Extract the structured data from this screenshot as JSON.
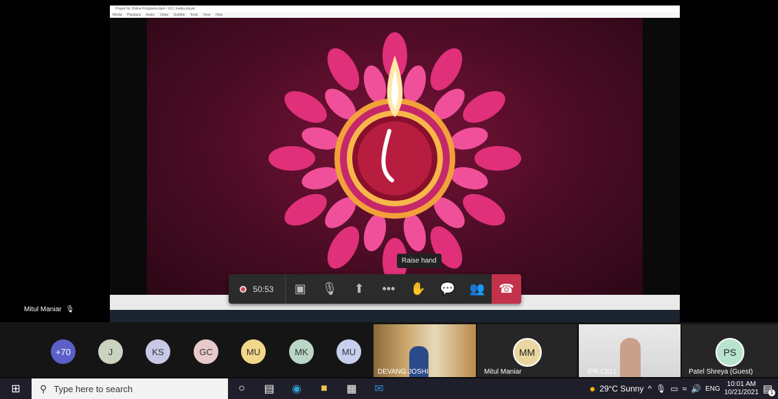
{
  "shared_window": {
    "title": "Prayer for Online Programs.mp4 - VLC media player",
    "menu": [
      "Media",
      "Playback",
      "Audio",
      "Video",
      "Subtitle",
      "Tools",
      "View",
      "Help"
    ]
  },
  "meeting": {
    "timer": "50:53",
    "tooltip": "Raise hand",
    "presenter_name": "Mitul Maniar"
  },
  "participants": {
    "overflow": "+70",
    "avatars": [
      {
        "initials": "J",
        "color": "#c9d3c0"
      },
      {
        "initials": "KS",
        "color": "#c7c7e6"
      },
      {
        "initials": "GC",
        "color": "#e8c9c9"
      },
      {
        "initials": "MU",
        "color": "#f2d68a"
      },
      {
        "initials": "MK",
        "color": "#b9d6c6"
      },
      {
        "initials": "MU",
        "color": "#c7cfee"
      }
    ],
    "tiles": [
      {
        "label": "DEVANG JOSHI"
      },
      {
        "label": "Mitul Maniar",
        "initials": "MM"
      },
      {
        "label": "IPR CELL"
      },
      {
        "label": "Patel Shreya (Guest)",
        "initials": "PS"
      }
    ]
  },
  "taskbar": {
    "search_placeholder": "Type here to search",
    "weather": "29°C  Sunny",
    "lang": "ENG",
    "time": "10:01 AM",
    "date": "10/21/2021",
    "notif_count": "1"
  }
}
